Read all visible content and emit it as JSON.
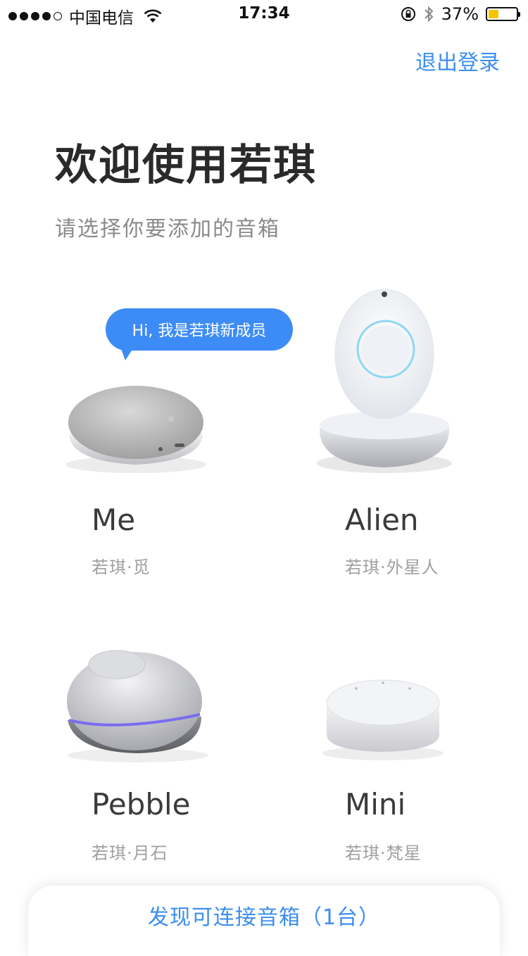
{
  "status_bar": {
    "carrier": "中国电信",
    "time": "17:34",
    "battery_percent": "37%",
    "battery_level": 0.37,
    "battery_color": "#f5c400"
  },
  "header": {
    "logout_label": "退出登录",
    "title": "欢迎使用若琪",
    "subtitle": "请选择你要添加的音箱"
  },
  "bubble": {
    "text": "Hi, 我是若琪新成员"
  },
  "devices": [
    {
      "name": "Me",
      "subtitle": "若琪·觅"
    },
    {
      "name": "Alien",
      "subtitle": "若琪·外星人"
    },
    {
      "name": "Pebble",
      "subtitle": "若琪·月石"
    },
    {
      "name": "Mini",
      "subtitle": "若琪·梵星"
    }
  ],
  "footer": {
    "discover_label": "发现可连接音箱（1台）"
  },
  "colors": {
    "accent": "#3b8ef0",
    "bubble": "#3d8cf5"
  }
}
